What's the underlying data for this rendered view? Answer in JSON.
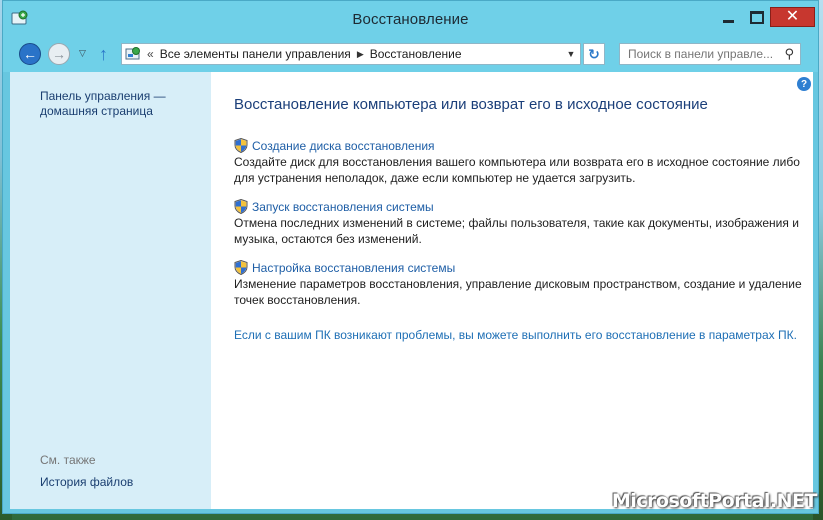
{
  "window": {
    "title": "Восстановление",
    "close_symbol": "✕"
  },
  "nav": {
    "back_symbol": "←",
    "forward_symbol": "→",
    "up_symbol": "↑",
    "refresh_symbol": "↻",
    "address": {
      "prefix": "«",
      "crumb_1": "Все элементы панели управления",
      "crumb_2": "Восстановление"
    },
    "search_placeholder": "Поиск в панели управле..."
  },
  "sidebar": {
    "home_link": "Панель управления — домашняя страница",
    "see_also": "См. также",
    "file_history": "История файлов"
  },
  "main": {
    "title": "Восстановление компьютера или возврат его в исходное состояние",
    "items": [
      {
        "label": "Создание диска восстановления",
        "description": "Создайте диск для восстановления вашего компьютера или возврата его в исходное состояние либо для устранения неполадок, даже если компьютер не удается загрузить."
      },
      {
        "label": "Запуск восстановления системы",
        "description": "Отмена последних изменений в системе; файлы пользователя, такие как документы, изображения и музыка, остаются без изменений."
      },
      {
        "label": "Настройка восстановления системы",
        "description": "Изменение параметров восстановления, управление дисковым пространством, создание и удаление точек восстановления."
      }
    ],
    "pc_settings_link": "Если с вашим ПК возникают проблемы, вы можете выполнить его восстановление в параметрах ПК.",
    "help_symbol": "?"
  },
  "watermark": "MicrosoftPortal.NET",
  "colors": {
    "chrome": "#6fd0e8",
    "sidebar": "#d7eef8",
    "link": "#1e5ea6",
    "title": "#1b3f7a",
    "close": "#c7372f"
  },
  "icons": [
    "app-icon",
    "back-icon",
    "forward-icon",
    "up-arrow-icon",
    "control-panel-icon",
    "refresh-icon",
    "search-icon",
    "shield-icon",
    "help-icon"
  ]
}
